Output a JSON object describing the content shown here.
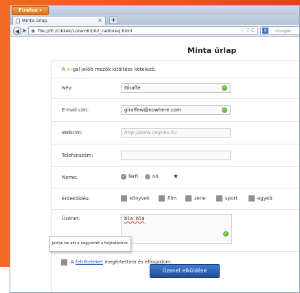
{
  "browser": {
    "app_button": "Firefox ▾",
    "tab_title": "Minta űrlap",
    "tab_close": "×",
    "new_tab": "+",
    "url": "file:///E:/Cikkek/Lorem63/02_radioreq.html",
    "search_placeholder": "Google",
    "url_icons": "☆ ▽ C"
  },
  "form": {
    "title": "Minta űrlap",
    "notice_prefix": "A",
    "notice_suffix": "-gal jelölt mezők kitöltése kötelező.",
    "name_label": "Név:",
    "name_value": "Giraffe",
    "email_label": "E-mail cím:",
    "email_value": "giraffew@nowhere.com",
    "web_label": "Webcím:",
    "web_placeholder": "http://www.cegnev.hu",
    "phone_label": "Telefonszám:",
    "gender_label": "Neme:",
    "gender_options": [
      "férfi",
      "nő"
    ],
    "interests_label": "Érdeklődés:",
    "interests": [
      "könyvek",
      "film",
      "zene",
      "sport",
      "egyéb"
    ],
    "message_label": "Üzenet:",
    "message_value": "bla bla",
    "terms_prefix": "A",
    "terms_link": "feltételeket",
    "terms_suffix": "megértettem és elfogadom.",
    "tooltip": "Jelölje be ezt a négyzetet a folytatáshoz.",
    "submit": "Üzenet elküldése"
  },
  "colors": {
    "desktop": "#e8531f",
    "valid": "#6fb93a",
    "required_star": "#f2c21a",
    "submit": "#1f4f9c"
  }
}
